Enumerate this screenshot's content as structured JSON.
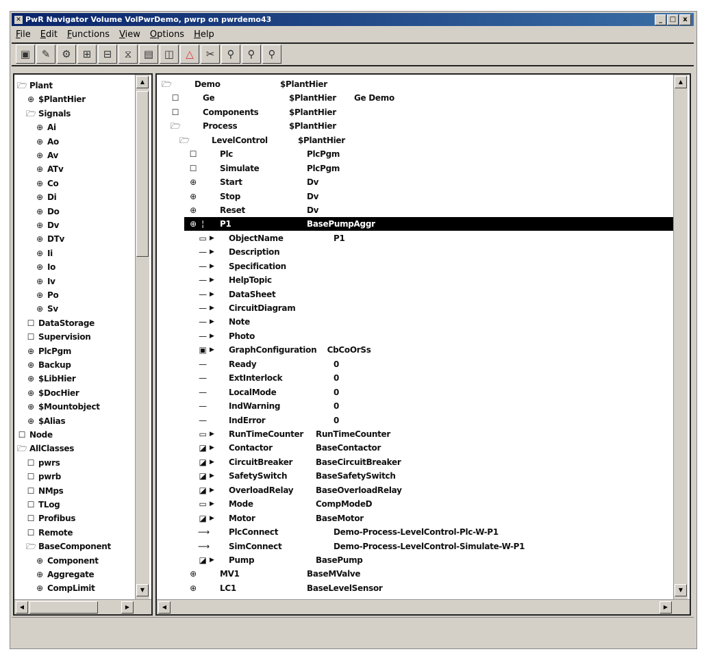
{
  "window": {
    "title": "PwR Navigator Volume VolPwrDemo, pwrp on pwrdemo43",
    "controls": [
      "_",
      "□",
      "x"
    ]
  },
  "menu": [
    "File",
    "Edit",
    "Functions",
    "View",
    "Options",
    "Help"
  ],
  "toolbar": [
    "save-icon",
    "edit-icon",
    "gear-icon",
    "objects-icon",
    "classes-icon",
    "hierarchy-icon",
    "briefcase-icon",
    "book-icon",
    "warning-icon",
    "scissors-icon",
    "zoom-in-icon",
    "zoom-out-icon",
    "zoom-reset-icon"
  ],
  "left_tree": [
    {
      "l": 0,
      "i": "fo",
      "t": "Plant"
    },
    {
      "l": 1,
      "i": "ob",
      "t": "$PlantHier"
    },
    {
      "l": 1,
      "i": "fo",
      "t": "Signals"
    },
    {
      "l": 2,
      "i": "ob",
      "t": "Ai"
    },
    {
      "l": 2,
      "i": "ob",
      "t": "Ao"
    },
    {
      "l": 2,
      "i": "ob",
      "t": "Av"
    },
    {
      "l": 2,
      "i": "ob",
      "t": "ATv"
    },
    {
      "l": 2,
      "i": "ob",
      "t": "Co"
    },
    {
      "l": 2,
      "i": "ob",
      "t": "Di"
    },
    {
      "l": 2,
      "i": "ob",
      "t": "Do"
    },
    {
      "l": 2,
      "i": "ob",
      "t": "Dv"
    },
    {
      "l": 2,
      "i": "ob",
      "t": "DTv"
    },
    {
      "l": 2,
      "i": "ob",
      "t": "Ii"
    },
    {
      "l": 2,
      "i": "ob",
      "t": "Io"
    },
    {
      "l": 2,
      "i": "ob",
      "t": "Iv"
    },
    {
      "l": 2,
      "i": "ob",
      "t": "Po"
    },
    {
      "l": 2,
      "i": "ob",
      "t": "Sv"
    },
    {
      "l": 1,
      "i": "fc",
      "t": "DataStorage"
    },
    {
      "l": 1,
      "i": "fc",
      "t": "Supervision"
    },
    {
      "l": 1,
      "i": "ob",
      "t": "PlcPgm"
    },
    {
      "l": 1,
      "i": "ob",
      "t": "Backup"
    },
    {
      "l": 1,
      "i": "ob",
      "t": "$LibHier"
    },
    {
      "l": 1,
      "i": "ob",
      "t": "$DocHier"
    },
    {
      "l": 1,
      "i": "ob",
      "t": "$Mountobject"
    },
    {
      "l": 1,
      "i": "ob",
      "t": "$Alias"
    },
    {
      "l": 0,
      "i": "fc",
      "t": "Node"
    },
    {
      "l": 0,
      "i": "fo",
      "t": "AllClasses"
    },
    {
      "l": 1,
      "i": "fc",
      "t": "pwrs"
    },
    {
      "l": 1,
      "i": "fc",
      "t": "pwrb"
    },
    {
      "l": 1,
      "i": "fc",
      "t": "NMps"
    },
    {
      "l": 1,
      "i": "fc",
      "t": "TLog"
    },
    {
      "l": 1,
      "i": "fc",
      "t": "Profibus"
    },
    {
      "l": 1,
      "i": "fc",
      "t": "Remote"
    },
    {
      "l": 1,
      "i": "fo",
      "t": "BaseComponent"
    },
    {
      "l": 2,
      "i": "ob",
      "t": "Component"
    },
    {
      "l": 2,
      "i": "ob",
      "t": "Aggregate"
    },
    {
      "l": 2,
      "i": "ob",
      "t": "CompLimit"
    }
  ],
  "right_tree": [
    {
      "l": 0,
      "i": "fo",
      "n": "Demo",
      "c": "$PlantHier"
    },
    {
      "l": 1,
      "i": "fc",
      "n": "Ge",
      "c": "$PlantHier",
      "d": "Ge Demo"
    },
    {
      "l": 1,
      "i": "fc",
      "n": "Components",
      "c": "$PlantHier"
    },
    {
      "l": 1,
      "i": "fo",
      "n": "Process",
      "c": "$PlantHier"
    },
    {
      "l": 2,
      "i": "fo",
      "n": "LevelControl",
      "c": "$PlantHier"
    },
    {
      "l": 3,
      "i": "fc",
      "n": "Plc",
      "c": "PlcPgm"
    },
    {
      "l": 3,
      "i": "fc",
      "n": "Simulate",
      "c": "PlcPgm"
    },
    {
      "l": 3,
      "i": "ob",
      "n": "Start",
      "c": "Dv"
    },
    {
      "l": 3,
      "i": "ob",
      "n": "Stop",
      "c": "Dv"
    },
    {
      "l": 3,
      "i": "ob",
      "n": "Reset",
      "c": "Dv"
    },
    {
      "l": 3,
      "i": "ob",
      "n": "P1",
      "c": "BasePumpAggr",
      "sel": true
    },
    {
      "l": 4,
      "i": "st",
      "a": 1,
      "n": "ObjectName",
      "c": "P1"
    },
    {
      "l": 4,
      "i": "at",
      "a": 1,
      "n": "Description",
      "c": ""
    },
    {
      "l": 4,
      "i": "at",
      "a": 1,
      "n": "Specification",
      "c": ""
    },
    {
      "l": 4,
      "i": "at",
      "a": 1,
      "n": "HelpTopic",
      "c": ""
    },
    {
      "l": 4,
      "i": "at",
      "a": 1,
      "n": "DataSheet",
      "c": ""
    },
    {
      "l": 4,
      "i": "at",
      "a": 1,
      "n": "CircuitDiagram",
      "c": ""
    },
    {
      "l": 4,
      "i": "at",
      "a": 1,
      "n": "Note",
      "c": ""
    },
    {
      "l": 4,
      "i": "at",
      "a": 1,
      "n": "Photo",
      "c": ""
    },
    {
      "l": 4,
      "i": "gr",
      "a": 1,
      "n": "GraphConfiguration",
      "c": "CbCoOrSs"
    },
    {
      "l": 4,
      "i": "at",
      "n": "Ready",
      "c": "0"
    },
    {
      "l": 4,
      "i": "at",
      "n": "ExtInterlock",
      "c": "0"
    },
    {
      "l": 4,
      "i": "at",
      "n": "LocalMode",
      "c": "0"
    },
    {
      "l": 4,
      "i": "at",
      "n": "IndWarning",
      "c": "0"
    },
    {
      "l": 4,
      "i": "at",
      "n": "IndError",
      "c": "0"
    },
    {
      "l": 4,
      "i": "st",
      "a": 1,
      "n": "RunTimeCounter",
      "c": "RunTimeCounter"
    },
    {
      "l": 4,
      "i": "ao",
      "a": 1,
      "n": "Contactor",
      "c": "BaseContactor"
    },
    {
      "l": 4,
      "i": "ao",
      "a": 1,
      "n": "CircuitBreaker",
      "c": "BaseCircuitBreaker"
    },
    {
      "l": 4,
      "i": "ao",
      "a": 1,
      "n": "SafetySwitch",
      "c": "BaseSafetySwitch"
    },
    {
      "l": 4,
      "i": "ao",
      "a": 1,
      "n": "OverloadRelay",
      "c": "BaseOverloadRelay"
    },
    {
      "l": 4,
      "i": "st",
      "a": 1,
      "n": "Mode",
      "c": "CompModeD"
    },
    {
      "l": 4,
      "i": "ao",
      "a": 1,
      "n": "Motor",
      "c": "BaseMotor"
    },
    {
      "l": 4,
      "i": "cn",
      "n": "PlcConnect",
      "c": "Demo-Process-LevelControl-Plc-W-P1"
    },
    {
      "l": 4,
      "i": "cn",
      "n": "SimConnect",
      "c": "Demo-Process-LevelControl-Simulate-W-P1"
    },
    {
      "l": 4,
      "i": "ao",
      "a": 1,
      "n": "Pump",
      "c": "BasePump"
    },
    {
      "l": 3,
      "i": "ob",
      "n": "MV1",
      "c": "BaseMValve"
    },
    {
      "l": 3,
      "i": "ob",
      "n": "LC1",
      "c": "BaseLevelSensor"
    }
  ]
}
